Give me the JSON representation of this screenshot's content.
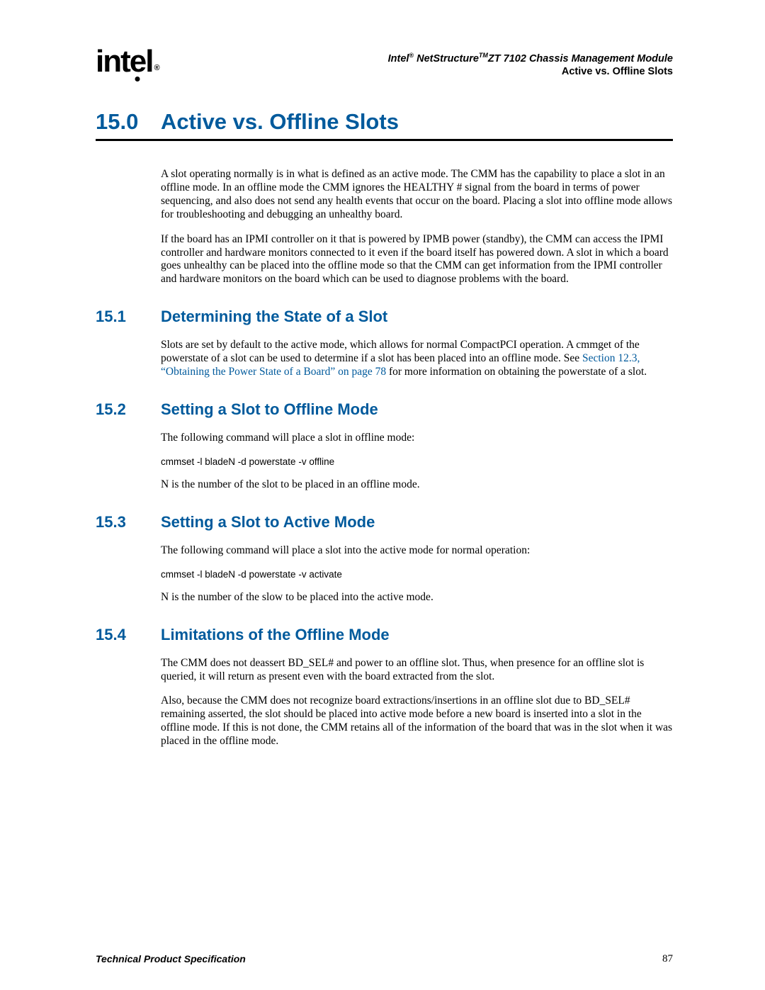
{
  "header": {
    "logo_text": "int",
    "logo_drop": "e",
    "logo_tail": "l",
    "logo_reg": "®",
    "line1_pre": "Intel",
    "line1_sup1": "®",
    "line1_mid": " NetStructure",
    "line1_sup2": "TM",
    "line1_post": "ZT 7102 Chassis Management Module",
    "line2": "Active vs. Offline Slots"
  },
  "chapter": {
    "num": "15.0",
    "title": "Active vs. Offline Slots"
  },
  "intro": {
    "p1": "A slot operating normally is in what is defined as an active mode. The CMM has the capability to place a slot in an offline mode. In an offline mode the CMM ignores the HEALTHY # signal from the board in terms of power sequencing, and also does not send any health events that occur on the board. Placing a slot into offline mode allows for troubleshooting and debugging an unhealthy board.",
    "p2": "If the board has an IPMI controller on it that is powered by IPMB power (standby), the CMM can access the IPMI controller and hardware monitors connected to it even if the board itself has powered down. A slot in which a board goes unhealthy can be placed into the offline mode so that the CMM can get information from the IPMI controller and hardware monitors on the board which can be used to diagnose problems with the board."
  },
  "s1": {
    "num": "15.1",
    "title": "Determining the State of a Slot",
    "p1_a": "Slots are set by default to the active mode, which allows for normal CompactPCI operation. A cmmget of the powerstate of a slot can be used to determine if a slot has been placed into an offline mode. See ",
    "p1_link": "Section 12.3, “Obtaining the Power State of a Board” on page 78",
    "p1_b": " for more information on obtaining the powerstate of a slot."
  },
  "s2": {
    "num": "15.2",
    "title": "Setting a Slot to Offline Mode",
    "p1": "The following command will place a slot in offline mode:",
    "cmd": "cmmset -l bladeN -d powerstate -v offline",
    "p2": "N is the number of the slot to be placed in an offline mode."
  },
  "s3": {
    "num": "15.3",
    "title": "Setting a Slot to Active Mode",
    "p1": "The following command will place a slot into the active mode for normal operation:",
    "cmd": "cmmset -l bladeN -d powerstate -v activate",
    "p2": "N is the number of the slow to be placed into the active mode."
  },
  "s4": {
    "num": "15.4",
    "title": "Limitations of the Offline Mode",
    "p1": "The CMM does not deassert BD_SEL# and power to an offline slot. Thus, when presence for an offline slot is queried, it will return as present even with the board extracted from the slot.",
    "p2": "Also, because the CMM does not recognize board extractions/insertions in an offline slot due to BD_SEL# remaining asserted, the slot should be placed into active mode before a new board is inserted into a slot in the offline mode. If this is not done, the CMM retains all of the information of the board that was in the slot when it was placed in the offline mode."
  },
  "footer": {
    "left": "Technical Product Specification",
    "right": "87"
  }
}
